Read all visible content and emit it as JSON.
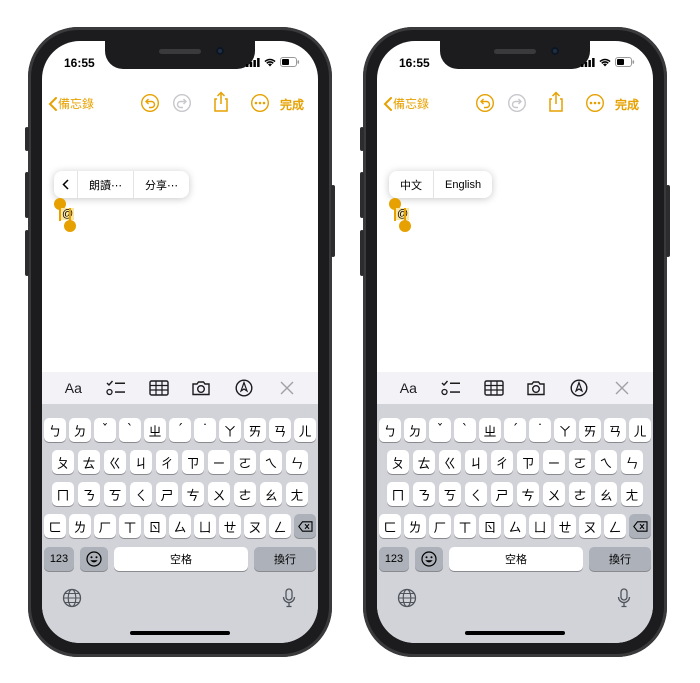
{
  "colors": {
    "accent": "#e6a100",
    "keyboard_bg": "#d1d3d9",
    "toolbar_bg": "#f2f2f7"
  },
  "status": {
    "time": "16:55"
  },
  "nav": {
    "back_label": "備忘錄",
    "done_label": "完成"
  },
  "selection_text": "@",
  "left_popup": {
    "items": [
      "朗讀⋯",
      "分享⋯"
    ]
  },
  "right_popup": {
    "items": [
      "中文",
      "English"
    ]
  },
  "toolbar_icons": [
    "format-icon",
    "checklist-icon",
    "table-icon",
    "camera-icon",
    "markup-icon",
    "close-icon"
  ],
  "toolbar_format_label": "Aa",
  "keyboard": {
    "row1": [
      "ㄅ",
      "ㄉ",
      "ˇ",
      "ˋ",
      "ㄓ",
      "ˊ",
      "˙",
      "ㄚ",
      "ㄞ",
      "ㄢ",
      "ㄦ"
    ],
    "row2": [
      "ㄆ",
      "ㄊ",
      "ㄍ",
      "ㄐ",
      "ㄔ",
      "ㄗ",
      "ㄧ",
      "ㄛ",
      "ㄟ",
      "ㄣ"
    ],
    "row3": [
      "ㄇ",
      "ㄋ",
      "ㄎ",
      "ㄑ",
      "ㄕ",
      "ㄘ",
      "ㄨ",
      "ㄜ",
      "ㄠ",
      "ㄤ"
    ],
    "row4": [
      "ㄈ",
      "ㄌ",
      "ㄏ",
      "ㄒ",
      "ㄖ",
      "ㄙ",
      "ㄩ",
      "ㄝ",
      "ㄡ",
      "ㄥ"
    ],
    "numbers_label": "123",
    "space_label": "空格",
    "return_label": "換行"
  }
}
